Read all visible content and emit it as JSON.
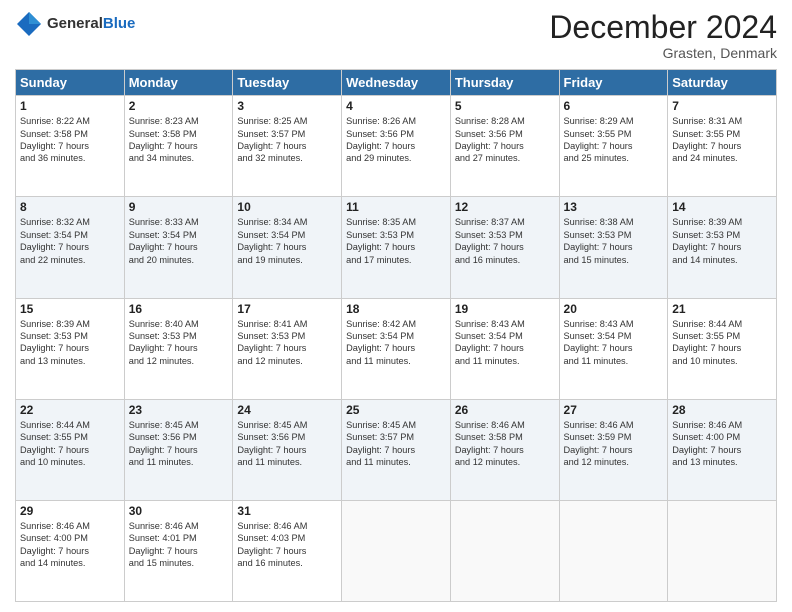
{
  "header": {
    "logo_general": "General",
    "logo_blue": "Blue",
    "month": "December 2024",
    "location": "Grasten, Denmark"
  },
  "weekdays": [
    "Sunday",
    "Monday",
    "Tuesday",
    "Wednesday",
    "Thursday",
    "Friday",
    "Saturday"
  ],
  "weeks": [
    [
      {
        "day": "1",
        "lines": [
          "Sunrise: 8:22 AM",
          "Sunset: 3:58 PM",
          "Daylight: 7 hours",
          "and 36 minutes."
        ]
      },
      {
        "day": "2",
        "lines": [
          "Sunrise: 8:23 AM",
          "Sunset: 3:58 PM",
          "Daylight: 7 hours",
          "and 34 minutes."
        ]
      },
      {
        "day": "3",
        "lines": [
          "Sunrise: 8:25 AM",
          "Sunset: 3:57 PM",
          "Daylight: 7 hours",
          "and 32 minutes."
        ]
      },
      {
        "day": "4",
        "lines": [
          "Sunrise: 8:26 AM",
          "Sunset: 3:56 PM",
          "Daylight: 7 hours",
          "and 29 minutes."
        ]
      },
      {
        "day": "5",
        "lines": [
          "Sunrise: 8:28 AM",
          "Sunset: 3:56 PM",
          "Daylight: 7 hours",
          "and 27 minutes."
        ]
      },
      {
        "day": "6",
        "lines": [
          "Sunrise: 8:29 AM",
          "Sunset: 3:55 PM",
          "Daylight: 7 hours",
          "and 25 minutes."
        ]
      },
      {
        "day": "7",
        "lines": [
          "Sunrise: 8:31 AM",
          "Sunset: 3:55 PM",
          "Daylight: 7 hours",
          "and 24 minutes."
        ]
      }
    ],
    [
      {
        "day": "8",
        "lines": [
          "Sunrise: 8:32 AM",
          "Sunset: 3:54 PM",
          "Daylight: 7 hours",
          "and 22 minutes."
        ]
      },
      {
        "day": "9",
        "lines": [
          "Sunrise: 8:33 AM",
          "Sunset: 3:54 PM",
          "Daylight: 7 hours",
          "and 20 minutes."
        ]
      },
      {
        "day": "10",
        "lines": [
          "Sunrise: 8:34 AM",
          "Sunset: 3:54 PM",
          "Daylight: 7 hours",
          "and 19 minutes."
        ]
      },
      {
        "day": "11",
        "lines": [
          "Sunrise: 8:35 AM",
          "Sunset: 3:53 PM",
          "Daylight: 7 hours",
          "and 17 minutes."
        ]
      },
      {
        "day": "12",
        "lines": [
          "Sunrise: 8:37 AM",
          "Sunset: 3:53 PM",
          "Daylight: 7 hours",
          "and 16 minutes."
        ]
      },
      {
        "day": "13",
        "lines": [
          "Sunrise: 8:38 AM",
          "Sunset: 3:53 PM",
          "Daylight: 7 hours",
          "and 15 minutes."
        ]
      },
      {
        "day": "14",
        "lines": [
          "Sunrise: 8:39 AM",
          "Sunset: 3:53 PM",
          "Daylight: 7 hours",
          "and 14 minutes."
        ]
      }
    ],
    [
      {
        "day": "15",
        "lines": [
          "Sunrise: 8:39 AM",
          "Sunset: 3:53 PM",
          "Daylight: 7 hours",
          "and 13 minutes."
        ]
      },
      {
        "day": "16",
        "lines": [
          "Sunrise: 8:40 AM",
          "Sunset: 3:53 PM",
          "Daylight: 7 hours",
          "and 12 minutes."
        ]
      },
      {
        "day": "17",
        "lines": [
          "Sunrise: 8:41 AM",
          "Sunset: 3:53 PM",
          "Daylight: 7 hours",
          "and 12 minutes."
        ]
      },
      {
        "day": "18",
        "lines": [
          "Sunrise: 8:42 AM",
          "Sunset: 3:54 PM",
          "Daylight: 7 hours",
          "and 11 minutes."
        ]
      },
      {
        "day": "19",
        "lines": [
          "Sunrise: 8:43 AM",
          "Sunset: 3:54 PM",
          "Daylight: 7 hours",
          "and 11 minutes."
        ]
      },
      {
        "day": "20",
        "lines": [
          "Sunrise: 8:43 AM",
          "Sunset: 3:54 PM",
          "Daylight: 7 hours",
          "and 11 minutes."
        ]
      },
      {
        "day": "21",
        "lines": [
          "Sunrise: 8:44 AM",
          "Sunset: 3:55 PM",
          "Daylight: 7 hours",
          "and 10 minutes."
        ]
      }
    ],
    [
      {
        "day": "22",
        "lines": [
          "Sunrise: 8:44 AM",
          "Sunset: 3:55 PM",
          "Daylight: 7 hours",
          "and 10 minutes."
        ]
      },
      {
        "day": "23",
        "lines": [
          "Sunrise: 8:45 AM",
          "Sunset: 3:56 PM",
          "Daylight: 7 hours",
          "and 11 minutes."
        ]
      },
      {
        "day": "24",
        "lines": [
          "Sunrise: 8:45 AM",
          "Sunset: 3:56 PM",
          "Daylight: 7 hours",
          "and 11 minutes."
        ]
      },
      {
        "day": "25",
        "lines": [
          "Sunrise: 8:45 AM",
          "Sunset: 3:57 PM",
          "Daylight: 7 hours",
          "and 11 minutes."
        ]
      },
      {
        "day": "26",
        "lines": [
          "Sunrise: 8:46 AM",
          "Sunset: 3:58 PM",
          "Daylight: 7 hours",
          "and 12 minutes."
        ]
      },
      {
        "day": "27",
        "lines": [
          "Sunrise: 8:46 AM",
          "Sunset: 3:59 PM",
          "Daylight: 7 hours",
          "and 12 minutes."
        ]
      },
      {
        "day": "28",
        "lines": [
          "Sunrise: 8:46 AM",
          "Sunset: 4:00 PM",
          "Daylight: 7 hours",
          "and 13 minutes."
        ]
      }
    ],
    [
      {
        "day": "29",
        "lines": [
          "Sunrise: 8:46 AM",
          "Sunset: 4:00 PM",
          "Daylight: 7 hours",
          "and 14 minutes."
        ]
      },
      {
        "day": "30",
        "lines": [
          "Sunrise: 8:46 AM",
          "Sunset: 4:01 PM",
          "Daylight: 7 hours",
          "and 15 minutes."
        ]
      },
      {
        "day": "31",
        "lines": [
          "Sunrise: 8:46 AM",
          "Sunset: 4:03 PM",
          "Daylight: 7 hours",
          "and 16 minutes."
        ]
      },
      null,
      null,
      null,
      null
    ]
  ]
}
